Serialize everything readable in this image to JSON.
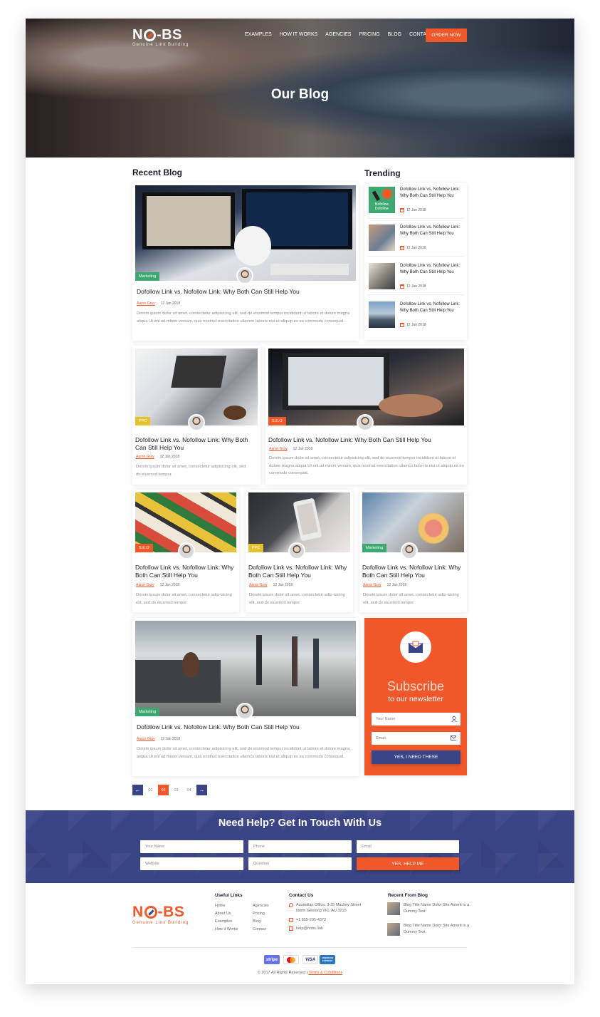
{
  "brand": {
    "name_left": "N",
    "name_right": "-BS",
    "tagline": "Genuine Link Building",
    "accent": "#f0582a",
    "navy": "#3a4587"
  },
  "nav": {
    "items": [
      "EXAMPLES",
      "HOW IT WORKS",
      "AGENCIES",
      "PRICING",
      "BLOG",
      "CONTACT"
    ],
    "cta": "ORDER NOW"
  },
  "hero": {
    "title": "Our Blog"
  },
  "recent": {
    "title": "Recent Blog"
  },
  "trending": {
    "title": "Trending",
    "items": [
      {
        "title": "Dofollow Link vs. Nofollow Link: Why Both Can Still Help You",
        "date": "12 Jan 2018"
      },
      {
        "title": "Dofollow Link vs. Nofollow Link: Why Both Can Still Help You",
        "date": "12 Jan 2018"
      },
      {
        "title": "Dofollow Link vs. Nofollow Link: Why Both Can Still Help You",
        "date": "12 Jan 2018"
      },
      {
        "title": "Dofollow Link vs. Nofollow Link: Why Both Can Still Help You",
        "date": "12 Jan 2018"
      }
    ],
    "first_thumb_text": "Nofollow Dofollow"
  },
  "posts": [
    {
      "tag": "Marketing",
      "title": "Dofollow Link vs. Nofollow Link: Why Both Can Still Help You",
      "author": "Aaron Gray",
      "date": "12 Jan 2018",
      "excerpt": "Dorem ipsum dolor sit amet, consectetur adipisicing elit, sed do eiusmod tempor incididunt ut labore et dolore magna aliqua Ut enl ad minim veniam, quis nostrud exercitation ullamco laboris nisi ut aliquip ex ea commodo consequat."
    },
    {
      "tag": "PPC",
      "title": "Dofollow Link vs. Nofollow Link: Why Both Can Still Help You",
      "author": "Aaron Gray",
      "date": "12 Jan 2018",
      "excerpt": "Dorem ipsum dolor sit amet, consectetur adipisicing elit, sed do eiusmod tempor."
    },
    {
      "tag": "S.E.O",
      "title": "Dofollow Link vs. Nofollow Link: Why Both Can Still Help You",
      "author": "Aaron Gray",
      "date": "12 Jan 2018",
      "excerpt": "Dorem ipsum dolor sit amet, consectetur adipisicing elit, sed do eiusmod tempor incididunt ut labore et dolore magna aliqua Ut enl ad minim veniam, quis nostrud exercitation ullamco labo-ris nisi ut aliquip ex ea commodo consequat."
    },
    {
      "tag": "S.E.O",
      "title": "Dofollow Link vs. Nofollow Link: Why Both Can Still Help You",
      "author": "Aaron Gray",
      "date": "12 Jan 2018",
      "excerpt": "Dorem ipsum dolor sit amet, consectetur adip-isicing elit, sed do eiusmod tempor"
    },
    {
      "tag": "PPC",
      "title": "Dofollow Link vs. Nofollow Link: Why Both Can Still Help You",
      "author": "Aaron Gray",
      "date": "12 Jan 2018",
      "excerpt": "Dorem ipsum dolor sit amet, consectetur adip-isicing elit, sed do eiusmod tempor"
    },
    {
      "tag": "Marketing",
      "title": "Dofollow Link vs. Nofollow Link: Why Both Can Still Help You",
      "author": "Aaron Gray",
      "date": "12 Jan 2018",
      "excerpt": "Dorem ipsum dolor sit amet, consectetur adip-isicing elit, sed do eiusmod tempor"
    },
    {
      "tag": "Marketing",
      "title": "Dofollow Link vs. Nofollow Link: Why Both Can Still Help You",
      "author": "Aaron Gray",
      "date": "12 Jan 2018",
      "excerpt": "Dorem ipsum dolor sit amet, consectetur adipisicing elit, sed do eiusmod tempor incididunt ut labore et dolore magna aliqua Ut enl ad minim veniam, quis nostrud exercitation ullamco laboris nisi ut aliquip ex ea commodo consequat."
    }
  ],
  "subscribe": {
    "title": "Subscribe",
    "subtitle": "to our newsletter",
    "name_placeholder": "Your Name",
    "email_placeholder": "Email",
    "button": "YES, I NEED THESE"
  },
  "pagination": {
    "prev": "←",
    "next": "→",
    "pages": [
      "01",
      "02",
      "03",
      "04"
    ],
    "active": "02"
  },
  "help": {
    "title": "Need Help? Get In Touch With Us",
    "fields": [
      "Your Name",
      "Phone",
      "Email",
      "Website",
      "Question"
    ],
    "button": "YES, HELP ME"
  },
  "footer": {
    "useful_links_title": "Useful Links",
    "links_col1": [
      "Home",
      "About Us",
      "Examples",
      "How it Works"
    ],
    "links_col2": [
      "Agencies",
      "Pricing",
      "Blog",
      "Contact"
    ],
    "contact_title": "Contact Us",
    "address": "Australian Office: 3-35 Mackey Street North Geelong VIC, AU 3215",
    "phone": "+1 855-205-4372",
    "email": "help@nobs.link",
    "recent_title": "Recent From Blog",
    "recent": [
      "Blog Title Name Dolor Site Amerit Is a Dummy Text",
      "Blog Title Name Dolor Site Amerit Is a Dummy Text"
    ],
    "payments": [
      "stripe",
      "mastercard",
      "VISA",
      "AMERICAN EXPRESS"
    ],
    "copyright": "© 2017 All Rights Reserved",
    "separator": "|",
    "terms": "Terms & Conditions"
  }
}
